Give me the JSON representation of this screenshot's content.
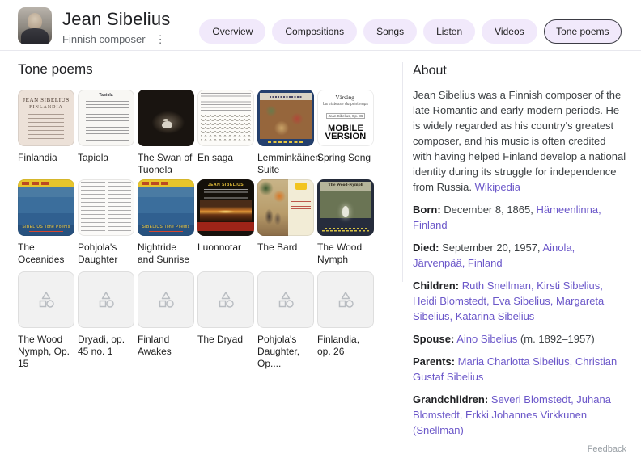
{
  "header": {
    "title": "Jean Sibelius",
    "subtitle": "Finnish composer",
    "more_icon": "⋮",
    "tabs": [
      {
        "label": "Overview",
        "selected": false
      },
      {
        "label": "Compositions",
        "selected": false
      },
      {
        "label": "Songs",
        "selected": false
      },
      {
        "label": "Listen",
        "selected": false
      },
      {
        "label": "Videos",
        "selected": false
      },
      {
        "label": "Tone poems",
        "selected": true
      }
    ]
  },
  "section": {
    "title": "Tone poems"
  },
  "albums": {
    "rows": [
      [
        {
          "label": "Finlandia",
          "cover": "finlandia",
          "cover_text": [
            "JEAN SIBELIUS",
            "FINLANDIA"
          ]
        },
        {
          "label": "Tapiola",
          "cover": "tapiola",
          "cover_text": [
            "Tapiola"
          ]
        },
        {
          "label": "The Swan of Tuonela",
          "cover": "swan"
        },
        {
          "label": "En saga",
          "cover": "ensaga"
        },
        {
          "label": "Lemminkäinen Suite",
          "cover": "lemminkainen"
        },
        {
          "label": "Spring Song",
          "cover": "spring",
          "cover_text": [
            "Vårsång.",
            "La tristesse du printemps",
            "Jean Sibelius, Op. 86",
            "MOBILE",
            "VERSION"
          ]
        }
      ],
      [
        {
          "label": "The Oceanides",
          "cover": "sea",
          "cover_text": [
            "SIBELIUS  Tone Poems"
          ]
        },
        {
          "label": "Pohjola's Daughter",
          "cover": "pohjola"
        },
        {
          "label": "Nightride and Sunrise",
          "cover": "sea",
          "cover_text": [
            "SIBELIUS  Tone Poems"
          ]
        },
        {
          "label": "Luonnotar",
          "cover": "luonnotar",
          "cover_text": [
            "JEAN SIBELIUS"
          ]
        },
        {
          "label": "The Bard",
          "cover": "bard"
        },
        {
          "label": "The Wood Nymph",
          "cover": "woodnymph",
          "cover_text": [
            "The Wood-Nymph"
          ]
        }
      ],
      [
        {
          "label": "The Wood Nymph, Op. 15",
          "cover": "placeholder"
        },
        {
          "label": "Dryadi, op. 45 no. 1",
          "cover": "placeholder"
        },
        {
          "label": "Finland Awakes",
          "cover": "placeholder"
        },
        {
          "label": "The Dryad",
          "cover": "placeholder"
        },
        {
          "label": "Pohjola's Daughter, Op....",
          "cover": "placeholder"
        },
        {
          "label": "Finlandia, op. 26",
          "cover": "placeholder"
        }
      ]
    ]
  },
  "about": {
    "title": "About",
    "description": "Jean Sibelius was a Finnish composer of the late Romantic and early-modern periods. He is widely regarded as his country's greatest composer, and his music is often credited with having helped Finland develop a national identity during its struggle for independence from Russia.",
    "description_link": "Wikipedia",
    "facts": [
      {
        "label": "Born",
        "parts": [
          {
            "text": "December 8, 1865, ",
            "link": false
          },
          {
            "text": "Hämeenlinna, Finland",
            "link": true
          }
        ]
      },
      {
        "label": "Died",
        "parts": [
          {
            "text": "September 20, 1957, ",
            "link": false
          },
          {
            "text": "Ainola, Järvenpää, Finland",
            "link": true
          }
        ]
      },
      {
        "label": "Children",
        "parts": [
          {
            "text": "Ruth Snellman, Kirsti Sibelius, Heidi Blomstedt, Eva Sibelius, Margareta Sibelius, Katarina Sibelius",
            "link": true
          }
        ]
      },
      {
        "label": "Spouse",
        "parts": [
          {
            "text": "Aino Sibelius",
            "link": true
          },
          {
            "text": " (m. 1892–1957)",
            "link": false
          }
        ]
      },
      {
        "label": "Parents",
        "parts": [
          {
            "text": "Maria Charlotta Sibelius, Christian Gustaf Sibelius",
            "link": true
          }
        ]
      },
      {
        "label": "Grandchildren",
        "parts": [
          {
            "text": "Severi Blomstedt, Juhana Blomstedt, Erkki Johannes Virkkunen (Snellman)",
            "link": true
          }
        ]
      }
    ],
    "feedback": "Feedback"
  },
  "colors": {
    "chip-bg": "#f1e9fb",
    "chip-border": "#3b3b44",
    "link": "#6b57c9",
    "divider": "#e8e8ee",
    "t1": "#202124",
    "t2": "#5f6368",
    "t3": "#9aa0a6"
  }
}
